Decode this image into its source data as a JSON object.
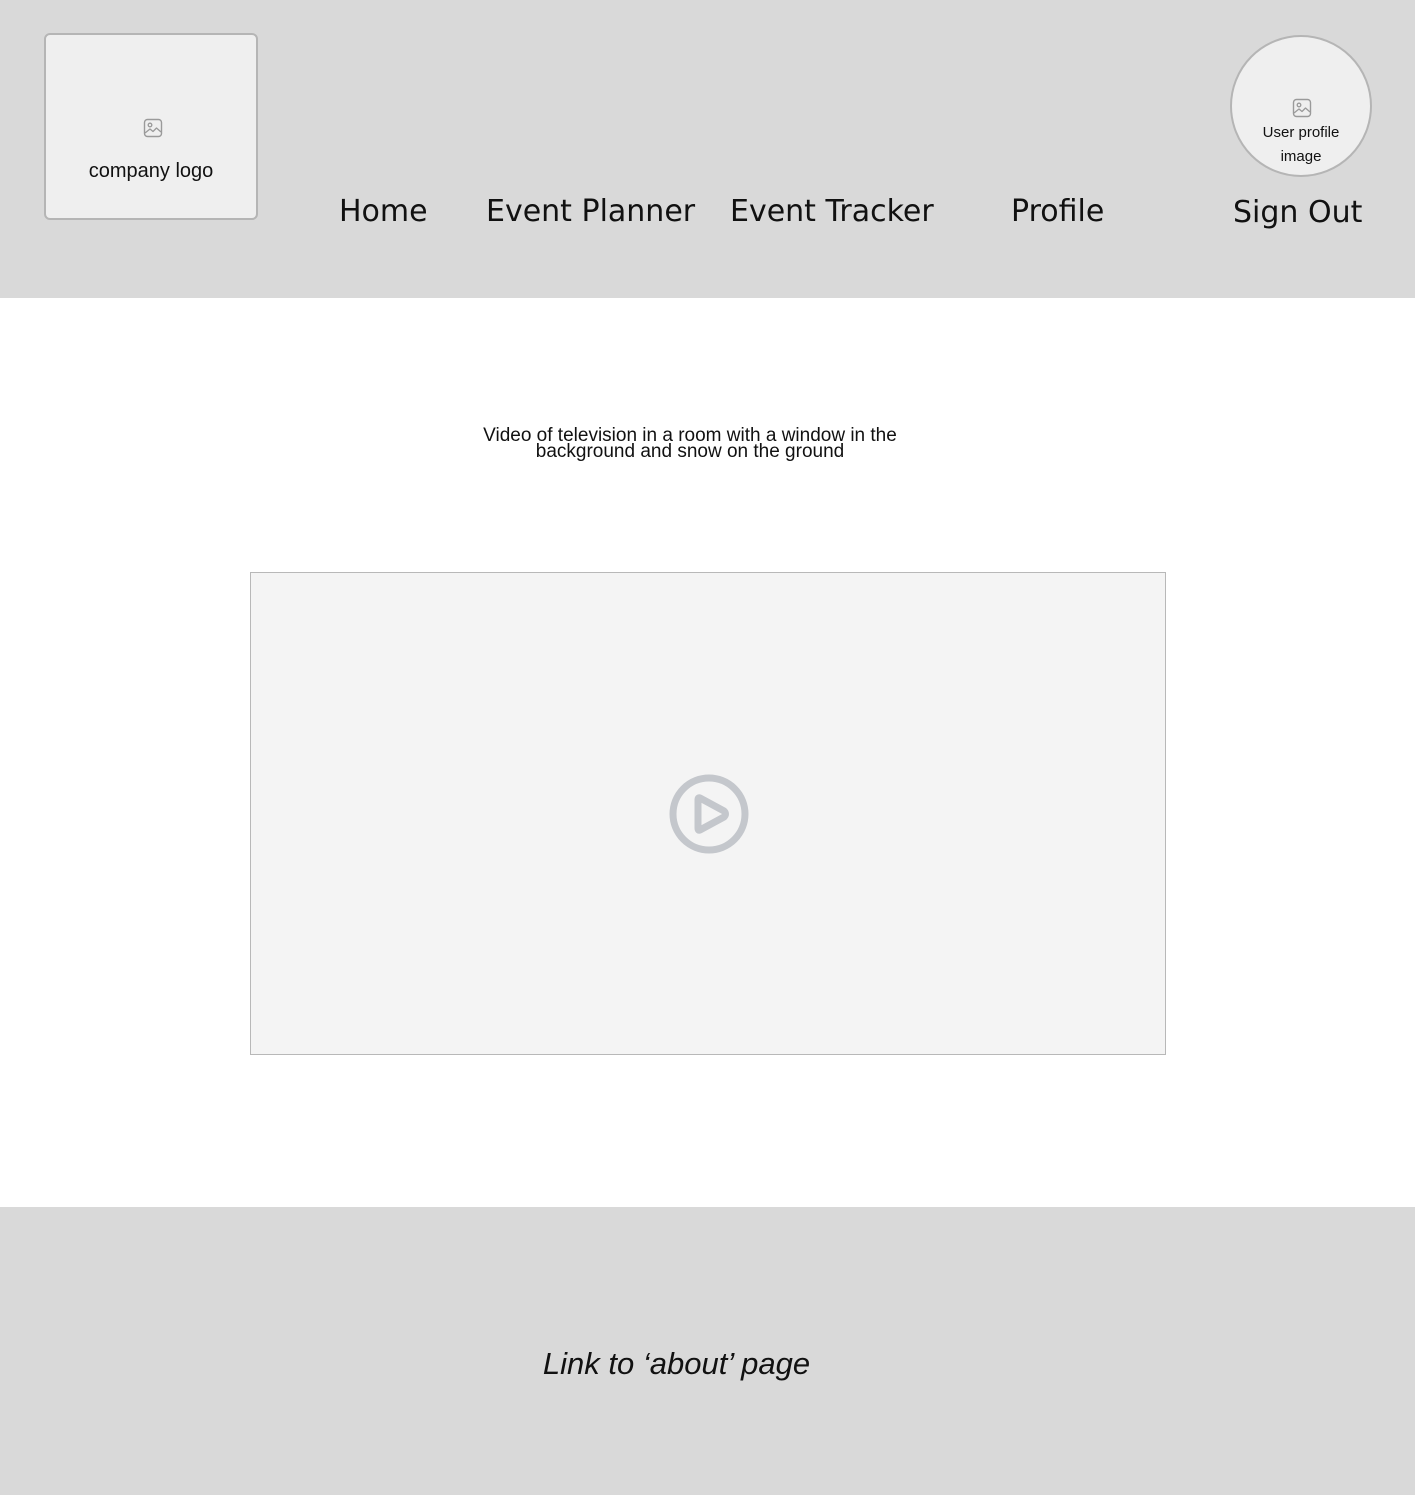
{
  "header": {
    "logo_text": "company logo",
    "nav": {
      "home": "Home",
      "event_planner": "Event Planner",
      "event_tracker": "Event Tracker",
      "profile": "Profile",
      "sign_out": "Sign Out"
    },
    "avatar_text": "User profile image"
  },
  "main": {
    "caption_line1": "Video of television in a room  with a window in the",
    "caption_line2": "background  and snow on the ground"
  },
  "footer": {
    "about_link": "Link to ‘about’ page"
  },
  "colors": {
    "header_bg": "#d9d9d9",
    "footer_bg": "#d9d9d9",
    "video_bg": "#f4f4f4",
    "play_icon": "#c4c7cc"
  }
}
